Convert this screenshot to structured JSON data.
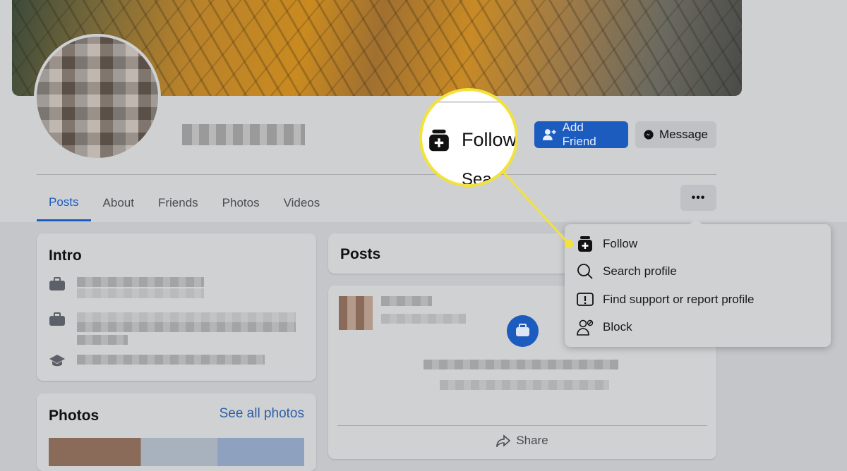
{
  "profile": {
    "actions": {
      "add_friend": "Add Friend",
      "message": "Message",
      "more": "•••"
    }
  },
  "tabs": [
    {
      "label": "Posts",
      "active": true
    },
    {
      "label": "About"
    },
    {
      "label": "Friends"
    },
    {
      "label": "Photos"
    },
    {
      "label": "Videos"
    }
  ],
  "intro": {
    "title": "Intro",
    "items": [
      {
        "icon": "briefcase-icon"
      },
      {
        "icon": "briefcase-icon"
      },
      {
        "icon": "graduation-cap-icon"
      }
    ]
  },
  "photos": {
    "title": "Photos",
    "see_all": "See all photos"
  },
  "posts": {
    "title": "Posts",
    "share": "Share"
  },
  "menu": {
    "items": [
      {
        "label": "Follow",
        "icon": "follow-icon"
      },
      {
        "label": "Search profile",
        "icon": "search-icon"
      },
      {
        "label": "Find support or report profile",
        "icon": "report-icon"
      },
      {
        "label": "Block",
        "icon": "block-user-icon"
      }
    ]
  },
  "callout": {
    "label": "Follow",
    "partial": "Sea"
  },
  "colors": {
    "accent": "#1d5cbf",
    "highlight": "#f3e23a"
  }
}
